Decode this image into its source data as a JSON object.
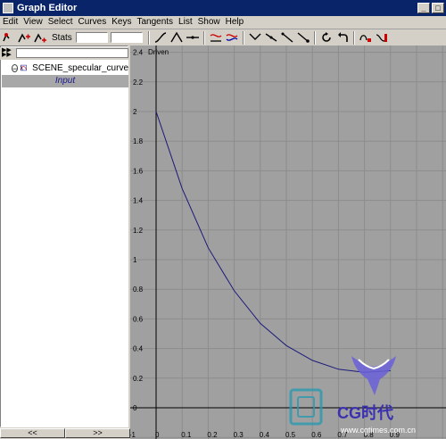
{
  "window": {
    "title": "Graph Editor",
    "buttons": [
      "_",
      "□"
    ]
  },
  "menu": [
    "Edit",
    "View",
    "Select",
    "Curves",
    "Keys",
    "Tangents",
    "List",
    "Show",
    "Help"
  ],
  "toolbar": {
    "stats_label": "Stats",
    "stats_value_1": "",
    "stats_value_2": ""
  },
  "outliner": {
    "filter_text": "",
    "expander": "−",
    "node_label": "SCENE_specular_curve",
    "input_label": "Input",
    "scroll_left": "<<",
    "scroll_right": ">>"
  },
  "graph": {
    "y_axis_name": "Driven",
    "y_ticks": [
      "2.4",
      "2.2",
      "2",
      "1.8",
      "1.6",
      "1.4",
      "1.2",
      "1",
      "0.8",
      "0.6",
      "0.4",
      "0.2",
      "0"
    ],
    "x_ticks": [
      "-1",
      "0",
      "0.1",
      "0.2",
      "0.3",
      "0.4",
      "0.5",
      "0.6",
      "0.7",
      "0.8",
      "0.9"
    ],
    "curve_color": "#1a1a7a",
    "background": "#a0a0a0",
    "grid_color": "#8c8c8c"
  },
  "chart_data": {
    "type": "line",
    "title": "",
    "xlabel": "",
    "ylabel": "Driven",
    "xlim": [
      -0.1,
      0.9
    ],
    "ylim": [
      0,
      2.4
    ],
    "series": [
      {
        "x": [
          0,
          0.1,
          0.2,
          0.3,
          0.4,
          0.5,
          0.6,
          0.7,
          0.8,
          0.9
        ],
        "y": [
          2.0,
          1.48,
          1.08,
          0.79,
          0.57,
          0.42,
          0.32,
          0.26,
          0.24,
          0.25
        ]
      }
    ]
  },
  "watermark": {
    "text": "CG时代",
    "url": "www.cgtimes.com.cn"
  }
}
